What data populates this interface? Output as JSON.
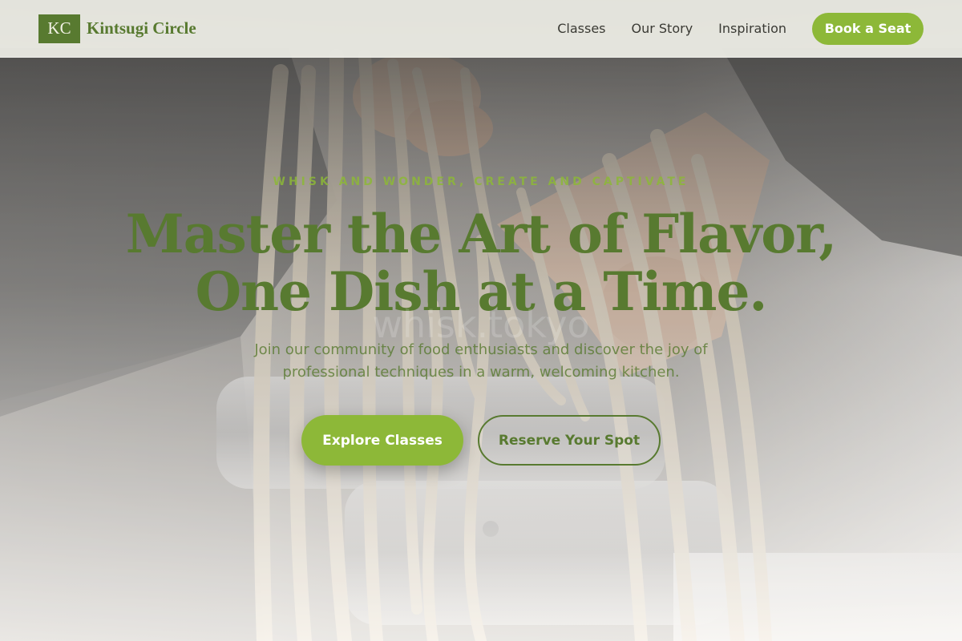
{
  "brand": {
    "mark": "KC",
    "name": "Kintsugi Circle"
  },
  "nav": {
    "items": [
      "Classes",
      "Our Story",
      "Inspiration"
    ],
    "cta": "Book a Seat"
  },
  "hero": {
    "eyebrow": "WHISK AND WONDER, CREATE AND CAPTIVATE",
    "headline_line1": "Master the Art of Flavor,",
    "headline_line2": "One Dish at a Time.",
    "watermark": "whisk.tokyo",
    "lede": "Join our community of food enthusiasts and discover the joy of professional techniques in a warm, welcoming kitchen.",
    "primary_cta": "Explore Classes",
    "secondary_cta": "Reserve Your Spot"
  },
  "colors": {
    "accent": "#8db838",
    "brand_green": "#587a30",
    "header_bg": "#f0f0e8"
  },
  "icons": {
    "hero_image": "fresh-pasta-machine-photo"
  }
}
